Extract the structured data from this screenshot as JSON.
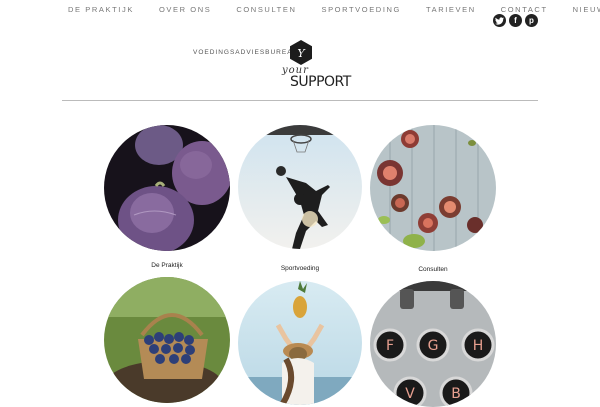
{
  "nav": {
    "items": [
      {
        "label": "DE PRAKTIJK"
      },
      {
        "label": "OVER ONS"
      },
      {
        "label": "CONSULTEN"
      },
      {
        "label": "SPORTVOEDING"
      },
      {
        "label": "TARIEVEN"
      },
      {
        "label": "CONTACT"
      },
      {
        "label": "NIEUWS"
      }
    ]
  },
  "social": {
    "twitter": "twitter-icon",
    "facebook": "facebook-icon",
    "pinterest": "pinterest-icon"
  },
  "brand": {
    "tagline": "VOEDINGSADVIESBUREAU",
    "script": "your",
    "word": "SUPPORT",
    "hex_letter": "Y"
  },
  "tiles": [
    {
      "caption": "De Praktijk",
      "image": "figs-photo"
    },
    {
      "caption": "Sportvoeding",
      "image": "basketball-photo"
    },
    {
      "caption": "Consulten",
      "image": "figs-table-photo"
    },
    {
      "caption": "",
      "image": "blueberries-photo"
    },
    {
      "caption": "",
      "image": "pineapple-photo"
    },
    {
      "caption": "",
      "image": "typewriter-photo"
    }
  ],
  "keys": [
    "F",
    "G",
    "H",
    "V",
    "B"
  ],
  "colors": {
    "nav": "#777777",
    "icon": "#222222",
    "divider": "#bbbbbb"
  }
}
